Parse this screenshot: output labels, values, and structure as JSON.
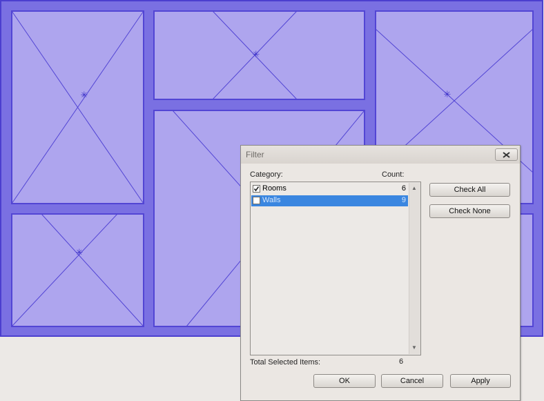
{
  "dialog": {
    "title": "Filter",
    "category_header": "Category:",
    "count_header": "Count:",
    "items": [
      {
        "name": "Rooms",
        "count": "6",
        "checked": true,
        "selected": false
      },
      {
        "name": "Walls",
        "count": "9",
        "checked": false,
        "selected": true
      }
    ],
    "total_label": "Total Selected Items:",
    "total_value": "6",
    "buttons": {
      "check_all": "Check All",
      "check_none": "Check None",
      "ok": "OK",
      "cancel": "Cancel",
      "apply": "Apply"
    }
  },
  "colors": {
    "canvas_fill": "#7a70e2",
    "room_fill": "#aea5ee",
    "room_stroke": "#5245d4",
    "selection": "#3a86e0"
  },
  "icons": {
    "close": "close-x-icon",
    "check": "checkmark-icon",
    "scroll_up": "scroll-up-arrow-icon",
    "scroll_down": "scroll-down-arrow-icon"
  }
}
